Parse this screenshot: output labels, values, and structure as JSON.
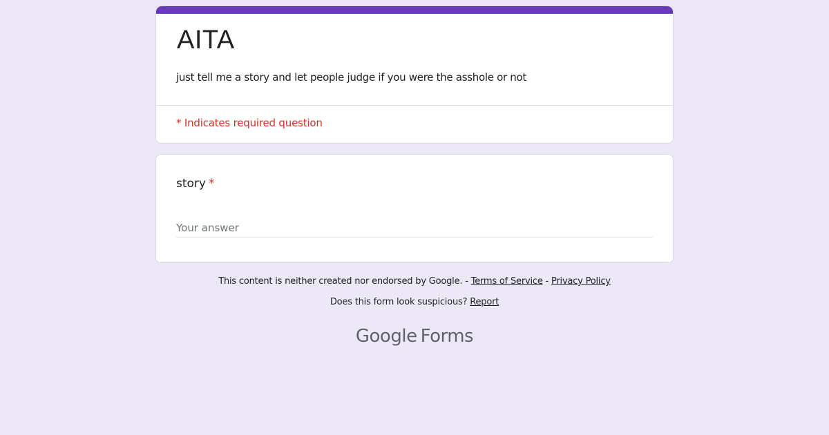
{
  "form": {
    "title": "AITA",
    "description": "just tell me a story and let people judge if you were the asshole or not",
    "required_note": "* Indicates required question",
    "accent_color": "#673ab7"
  },
  "question": {
    "label": "story",
    "required_marker": "*",
    "placeholder": "Your answer",
    "value": ""
  },
  "footer": {
    "disclaimer": "This content is neither created nor endorsed by Google.",
    "separator1": " - ",
    "terms_label": "Terms of Service",
    "separator2": " - ",
    "privacy_label": "Privacy Policy",
    "suspicious_prompt": "Does this form look suspicious?",
    "report_label": "Report"
  },
  "brand": {
    "google": "Google",
    "forms": "Forms"
  },
  "colors": {
    "background": "#ede8f8",
    "required": "#d93025"
  }
}
